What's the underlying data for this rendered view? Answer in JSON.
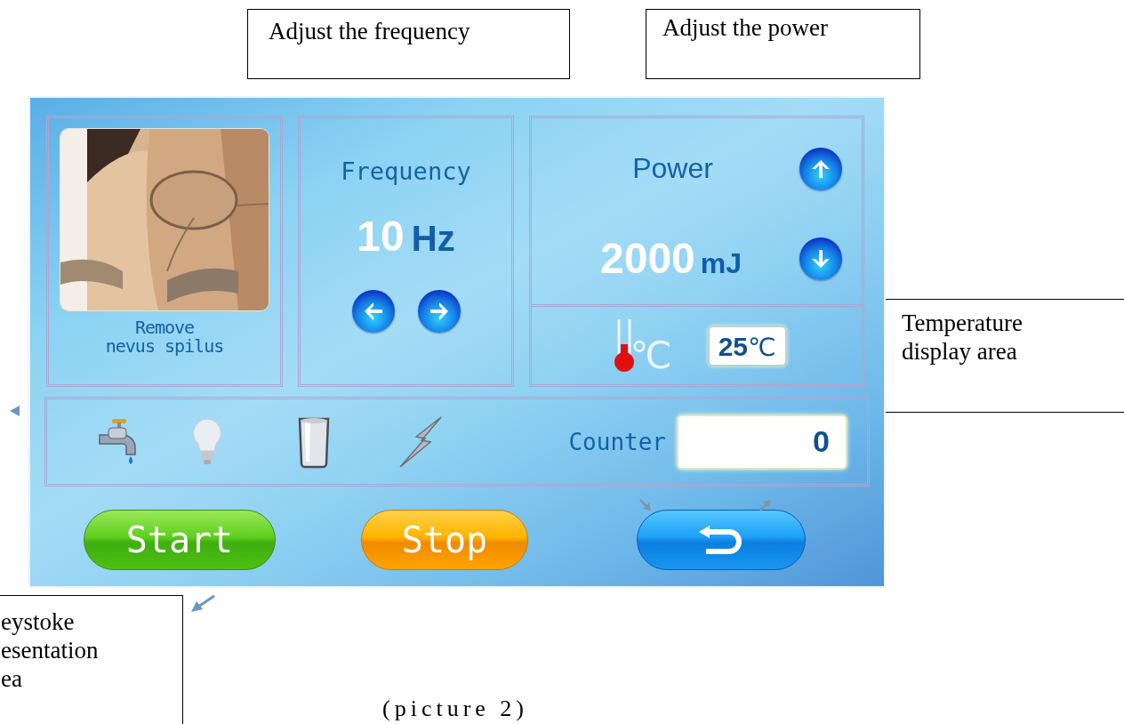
{
  "callouts": [
    {
      "kind": "frequency",
      "lines": [
        "Adjust the frequency"
      ]
    },
    {
      "kind": "power",
      "lines": [
        "Adjust the power"
      ]
    },
    {
      "kind": "temperature",
      "lines": [
        "Temperature",
        "display area"
      ]
    },
    {
      "kind": "keystroke",
      "lines": [
        "eystoke",
        "esentation",
        "ea"
      ]
    }
  ],
  "screen": {
    "treatment": {
      "lines": [
        "Remove",
        "nevus spilus"
      ]
    },
    "frequency": {
      "title": "Frequency",
      "value": "10",
      "unit": "Hz"
    },
    "power": {
      "title": "Power",
      "value": "2000",
      "unit": "mJ"
    },
    "temperature": {
      "sensor_unit": "℃",
      "value": "25",
      "unit": "℃"
    },
    "indicators": [
      {
        "kind": "water"
      },
      {
        "kind": "lamp"
      },
      {
        "kind": "cup"
      },
      {
        "kind": "lightning"
      }
    ],
    "counter": {
      "label": "Counter",
      "value": "0"
    },
    "buttons": [
      {
        "kind": "start",
        "label": "Start"
      },
      {
        "kind": "stop",
        "label": "Stop"
      },
      {
        "kind": "back"
      }
    ]
  },
  "caption": "(picture 2)"
}
